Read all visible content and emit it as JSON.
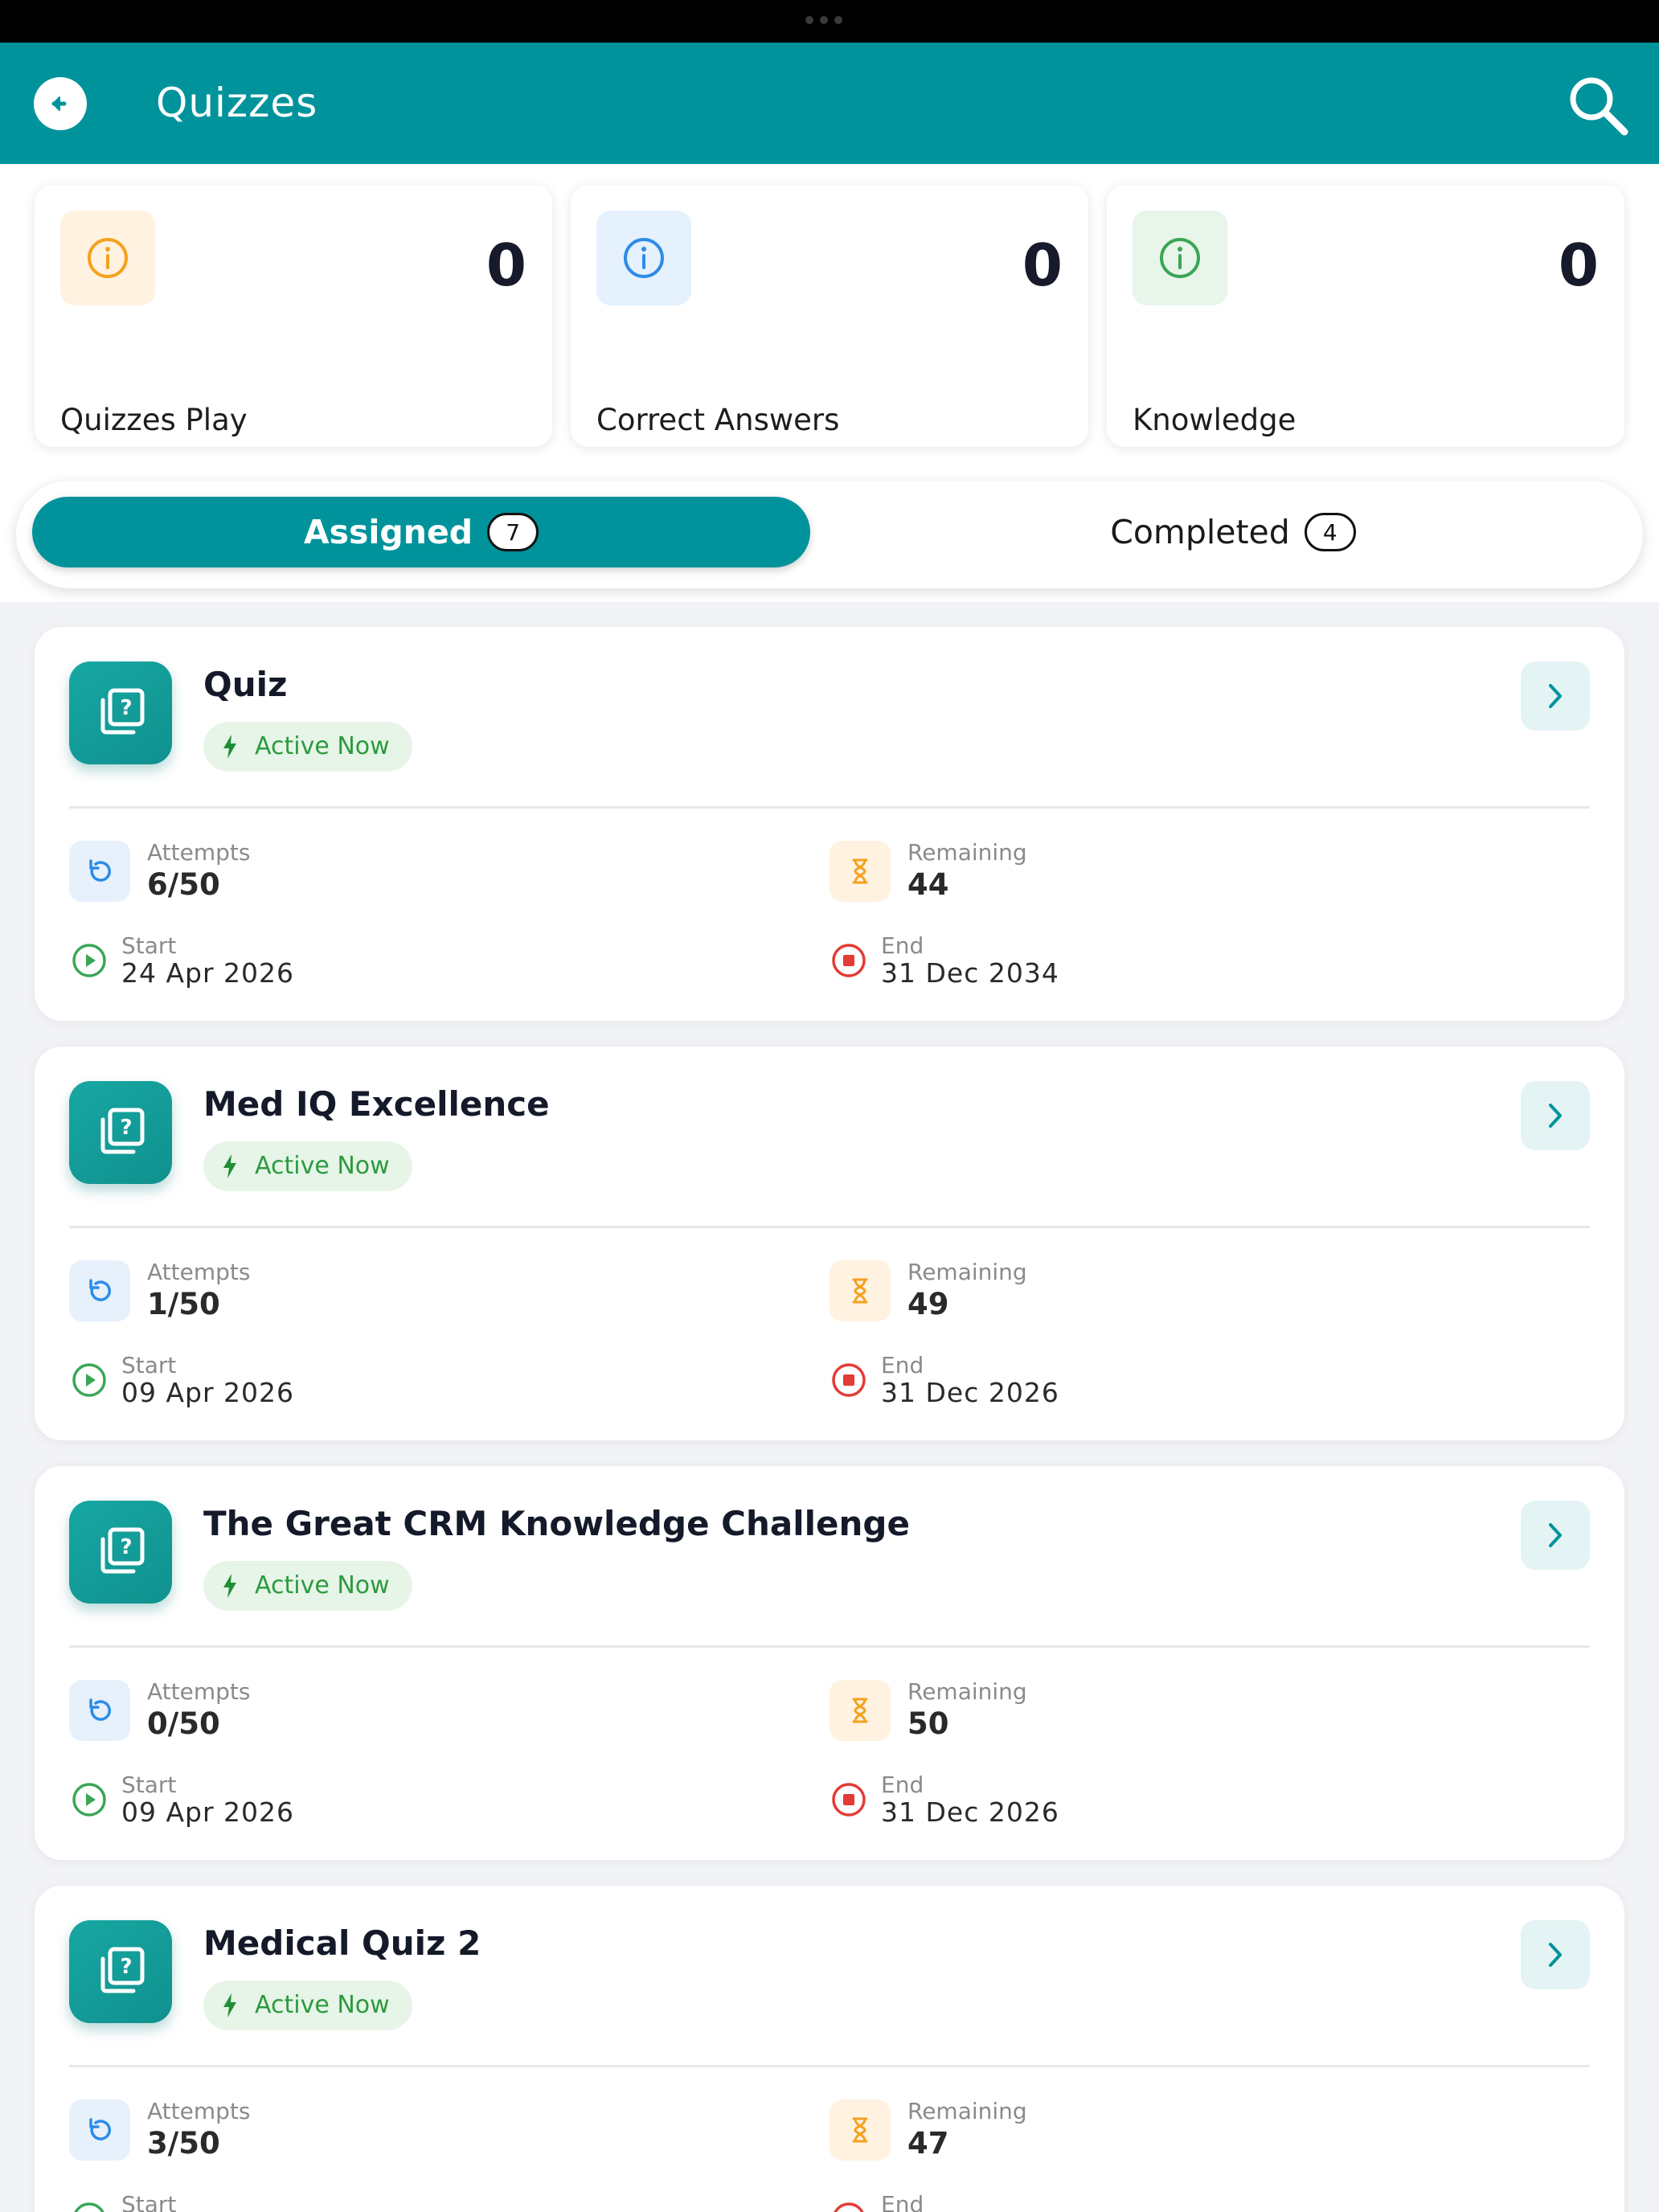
{
  "app": {
    "title": "Quizzes"
  },
  "colors": {
    "primary": "#00939b",
    "orange": "#f5a11f",
    "blue": "#2d8ce6",
    "green": "#2c9a3e",
    "red": "#e33b35"
  },
  "icons": {
    "back": "arrow-left-icon",
    "search": "search-icon",
    "info": "info-icon",
    "quiz": "quiz-library-icon",
    "bolt": "bolt-icon",
    "chevron": "chevron-right-icon",
    "attempts": "refresh-icon",
    "remaining": "hourglass-icon",
    "start": "play-circle-icon",
    "end": "stop-circle-icon"
  },
  "stats": [
    {
      "label": "Quizzes Play",
      "value": "0"
    },
    {
      "label": "Correct Answers",
      "value": "0"
    },
    {
      "label": "Knowledge",
      "value": "0"
    }
  ],
  "tabs": [
    {
      "label": "Assigned",
      "count": "7"
    },
    {
      "label": "Completed",
      "count": "4"
    }
  ],
  "labels": {
    "attempts": "Attempts",
    "remaining": "Remaining",
    "start": "Start",
    "end": "End"
  },
  "quizzes": [
    {
      "title": "Quiz",
      "status": "Active Now",
      "attempts": "6/50",
      "remaining": "44",
      "start": "24 Apr 2026",
      "end": "31 Dec 2034"
    },
    {
      "title": "Med IQ Excellence",
      "status": "Active Now",
      "attempts": "1/50",
      "remaining": "49",
      "start": "09 Apr 2026",
      "end": "31 Dec 2026"
    },
    {
      "title": "The Great CRM Knowledge Challenge",
      "status": "Active Now",
      "attempts": "0/50",
      "remaining": "50",
      "start": "09 Apr 2026",
      "end": "31 Dec 2026"
    },
    {
      "title": "Medical Quiz 2",
      "status": "Active Now",
      "attempts": "3/50",
      "remaining": "47"
    }
  ]
}
